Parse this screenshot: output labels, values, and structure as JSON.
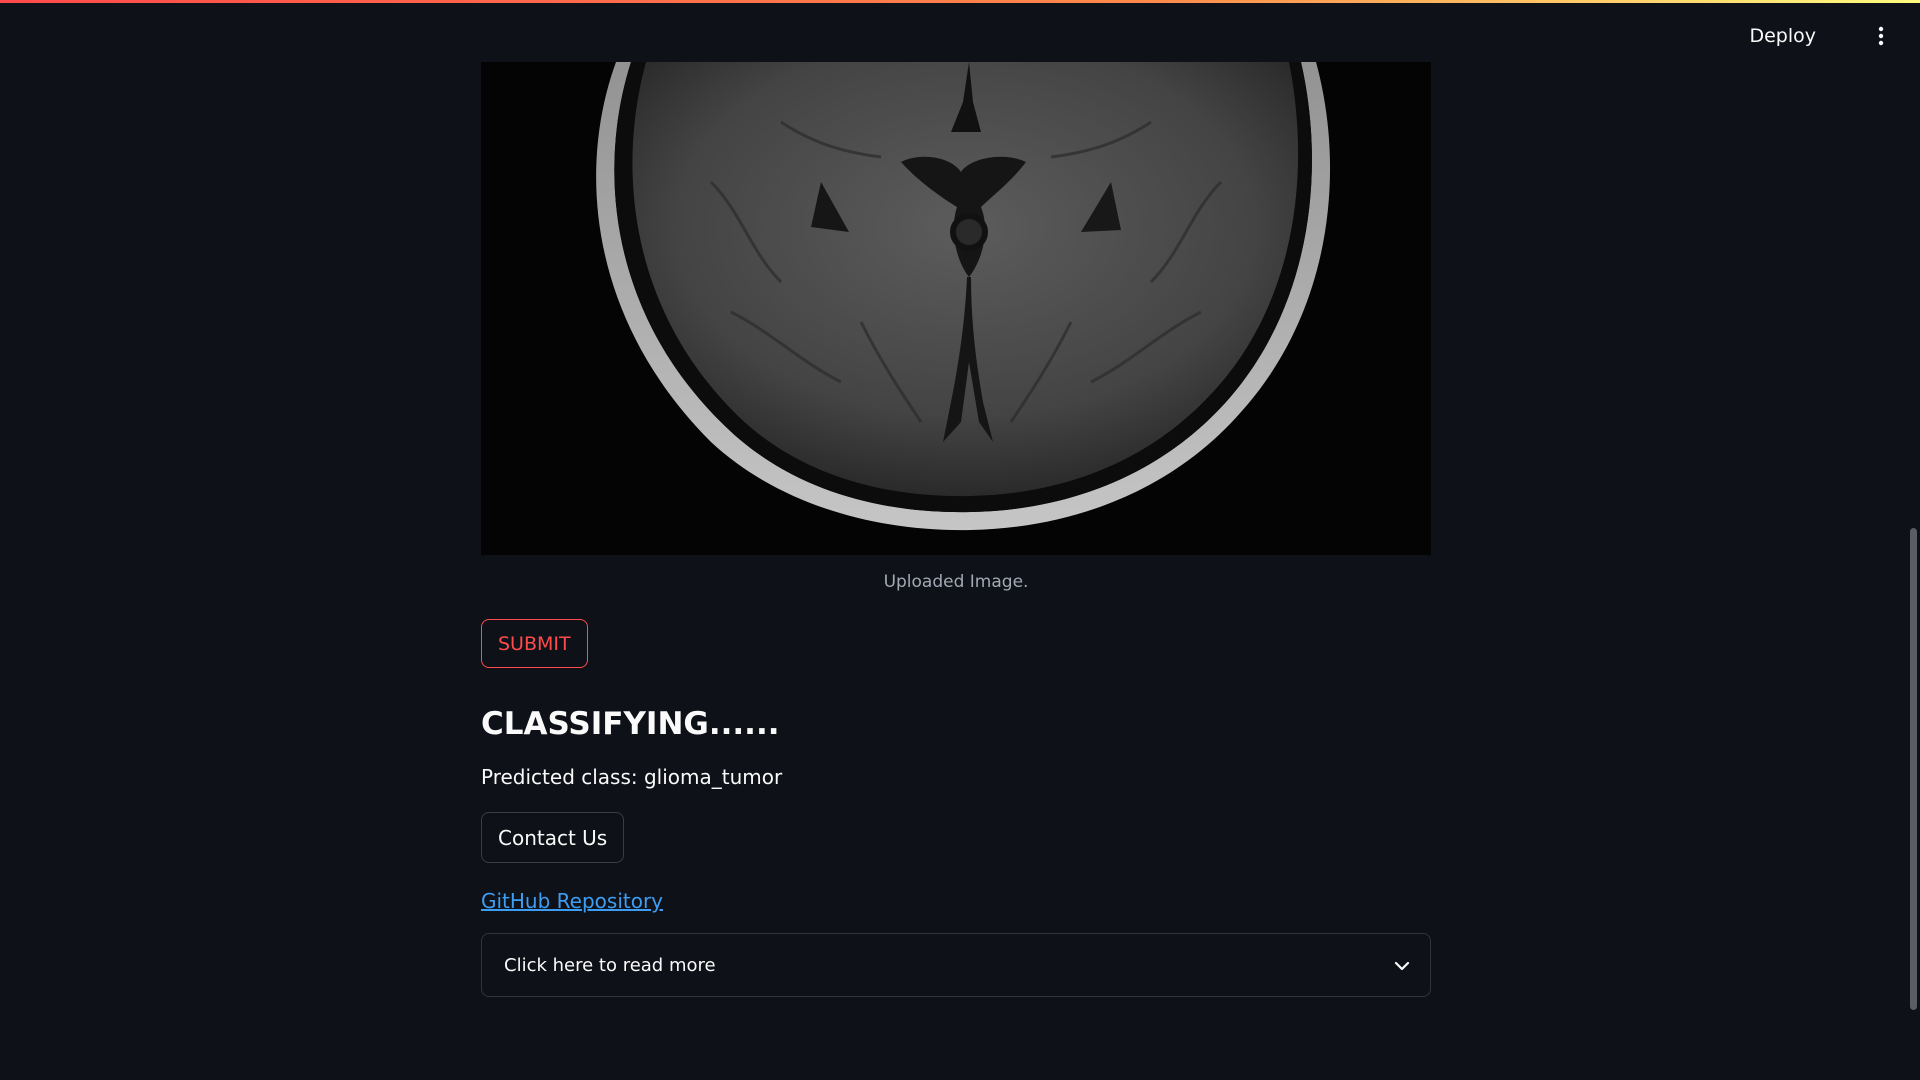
{
  "header": {
    "deploy_label": "Deploy",
    "menu_icon": "vertical-dots-icon"
  },
  "image": {
    "caption": "Uploaded Image."
  },
  "actions": {
    "submit_label": "SUBMIT",
    "contact_label": "Contact Us"
  },
  "result": {
    "heading": "CLASSIFYING......",
    "prediction": "Predicted class: glioma_tumor"
  },
  "links": {
    "github": "GitHub Repository"
  },
  "expander": {
    "label": "Click here to read more",
    "icon": "chevron-down-icon"
  },
  "colors": {
    "background": "#0e1117",
    "accent": "#ff4b4b",
    "link": "#3d9df3"
  }
}
